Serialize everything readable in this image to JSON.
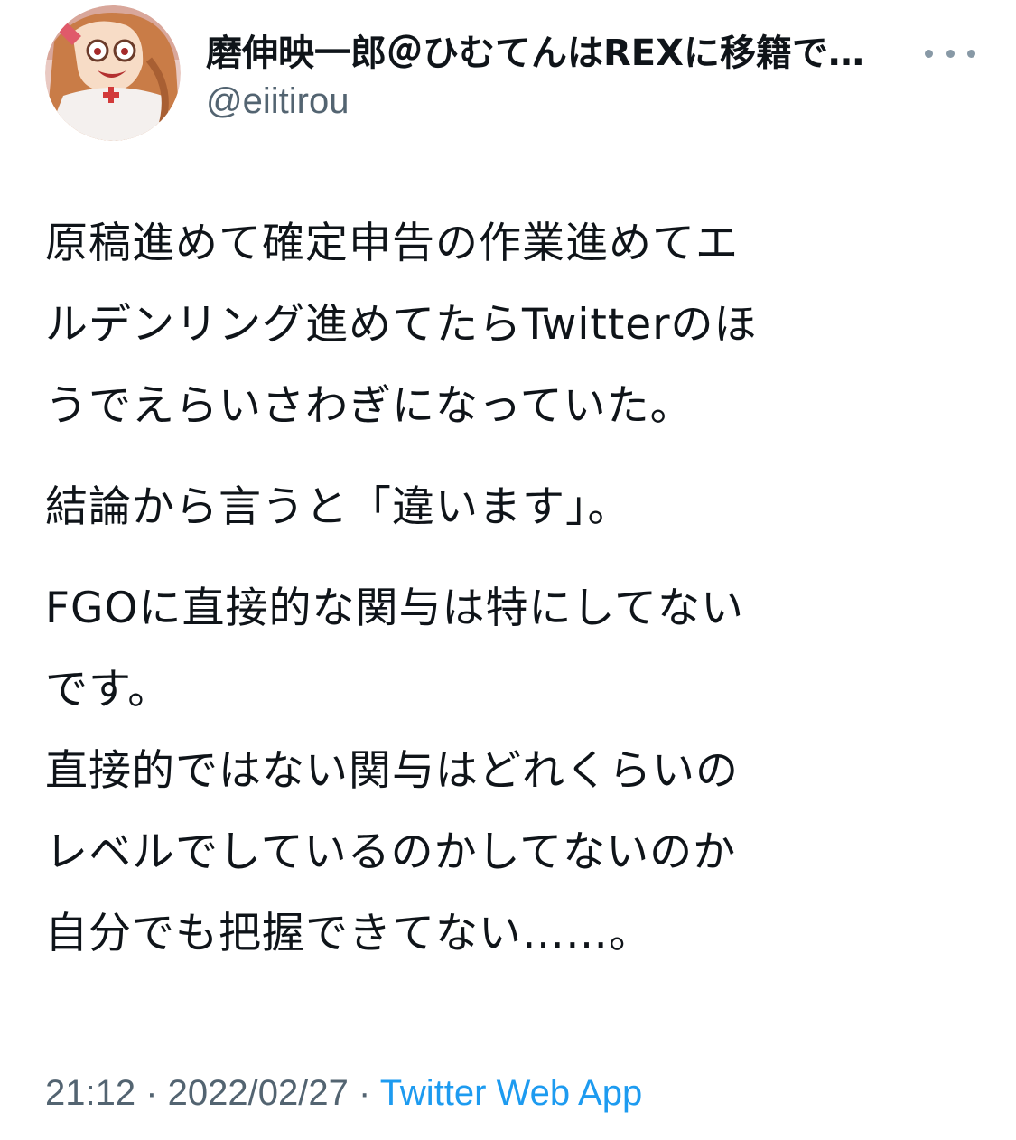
{
  "author": {
    "display_name": "磨伸映一郎＠ひむてんはREXに移籍で…",
    "handle": "@eiitirou",
    "avatar_icon": "avatar-illustration"
  },
  "more_icon": "more-horizontal-icon",
  "body": {
    "paragraphs": [
      {
        "lines": [
          "原稿進めて確定申告の作業進めてエ",
          "ルデンリング進めてたらTwitterのほ",
          "うでえらいさわぎになっていた。"
        ]
      },
      {
        "lines": [
          "結論から言うと「違います」。"
        ]
      },
      {
        "lines": [
          "FGOに直接的な関与は特にしてない",
          "です。",
          "直接的ではない関与はどれくらいの",
          "レベルでしているのかしてないのか",
          "自分でも把握できてない……。"
        ]
      }
    ]
  },
  "meta": {
    "time": "21:12",
    "separator": " · ",
    "date": "2022/02/27",
    "source": "Twitter Web App"
  },
  "colors": {
    "text": "#0f1419",
    "secondary": "#536471",
    "link": "#1d9bf0"
  }
}
